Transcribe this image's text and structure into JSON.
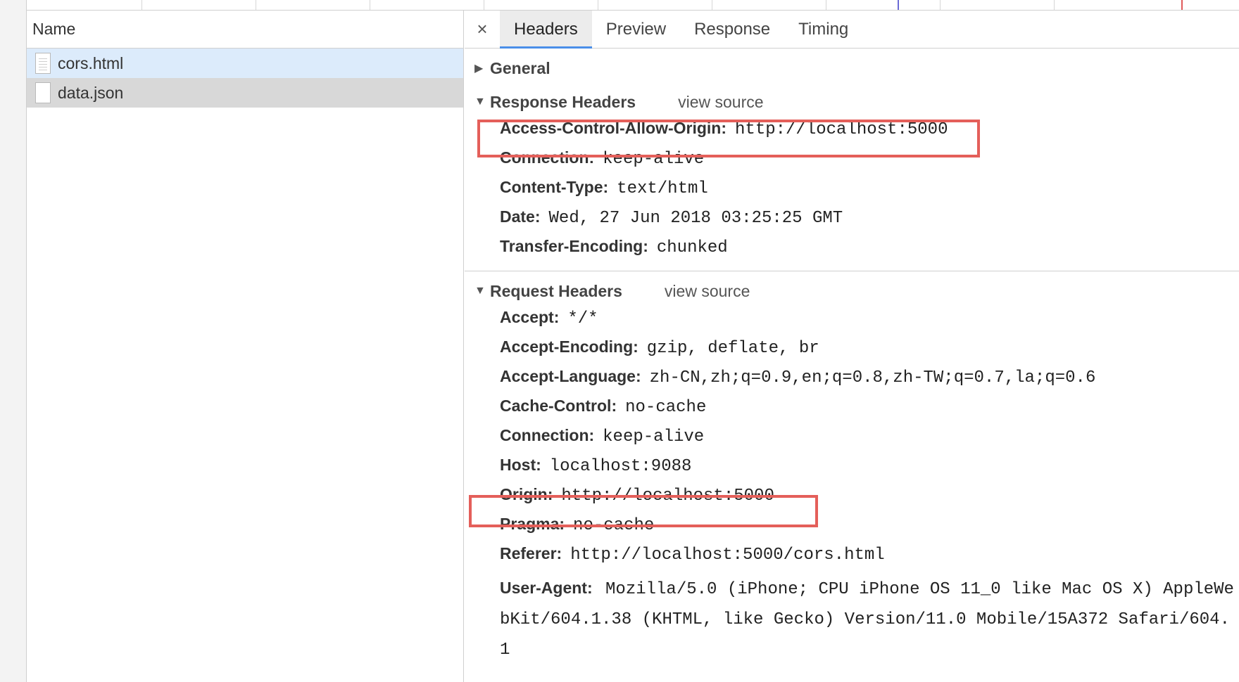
{
  "list": {
    "column_header": "Name",
    "requests": [
      {
        "name": "cors.html",
        "icon": "document-icon",
        "state": "selected"
      },
      {
        "name": "data.json",
        "icon": "blank-file-icon",
        "state": "hover"
      }
    ]
  },
  "tabs": {
    "close_symbol": "×",
    "items": [
      "Headers",
      "Preview",
      "Response",
      "Timing"
    ],
    "active": "Headers"
  },
  "sections": {
    "general": {
      "label": "General",
      "expanded": false
    },
    "response": {
      "label": "Response Headers",
      "view_source": "view source",
      "headers": [
        {
          "key": "Access-Control-Allow-Origin:",
          "value": "http://localhost:5000",
          "highlighted": true
        },
        {
          "key": "Connection:",
          "value": "keep-alive"
        },
        {
          "key": "Content-Type:",
          "value": "text/html"
        },
        {
          "key": "Date:",
          "value": "Wed, 27 Jun 2018 03:25:25 GMT"
        },
        {
          "key": "Transfer-Encoding:",
          "value": "chunked"
        }
      ]
    },
    "request": {
      "label": "Request Headers",
      "view_source": "view source",
      "headers": [
        {
          "key": "Accept:",
          "value": "*/*"
        },
        {
          "key": "Accept-Encoding:",
          "value": "gzip, deflate, br"
        },
        {
          "key": "Accept-Language:",
          "value": "zh-CN,zh;q=0.9,en;q=0.8,zh-TW;q=0.7,la;q=0.6"
        },
        {
          "key": "Cache-Control:",
          "value": "no-cache"
        },
        {
          "key": "Connection:",
          "value": "keep-alive"
        },
        {
          "key": "Host:",
          "value": "localhost:9088"
        },
        {
          "key": "Origin:",
          "value": "http://localhost:5000",
          "highlighted": true
        },
        {
          "key": "Pragma:",
          "value": "no-cache"
        },
        {
          "key": "Referer:",
          "value": "http://localhost:5000/cors.html"
        },
        {
          "key": "User-Agent:",
          "value": "Mozilla/5.0 (iPhone; CPU iPhone OS 11_0 like Mac OS X) AppleWebKit/604.1.38 (KHTML, like Gecko) Version/11.0 Mobile/15A372 Safari/604.1"
        }
      ]
    }
  },
  "colors": {
    "highlight_box": "#e45f5a",
    "active_tab_underline": "#4a8ee8",
    "selected_row": "#dcebfb"
  }
}
